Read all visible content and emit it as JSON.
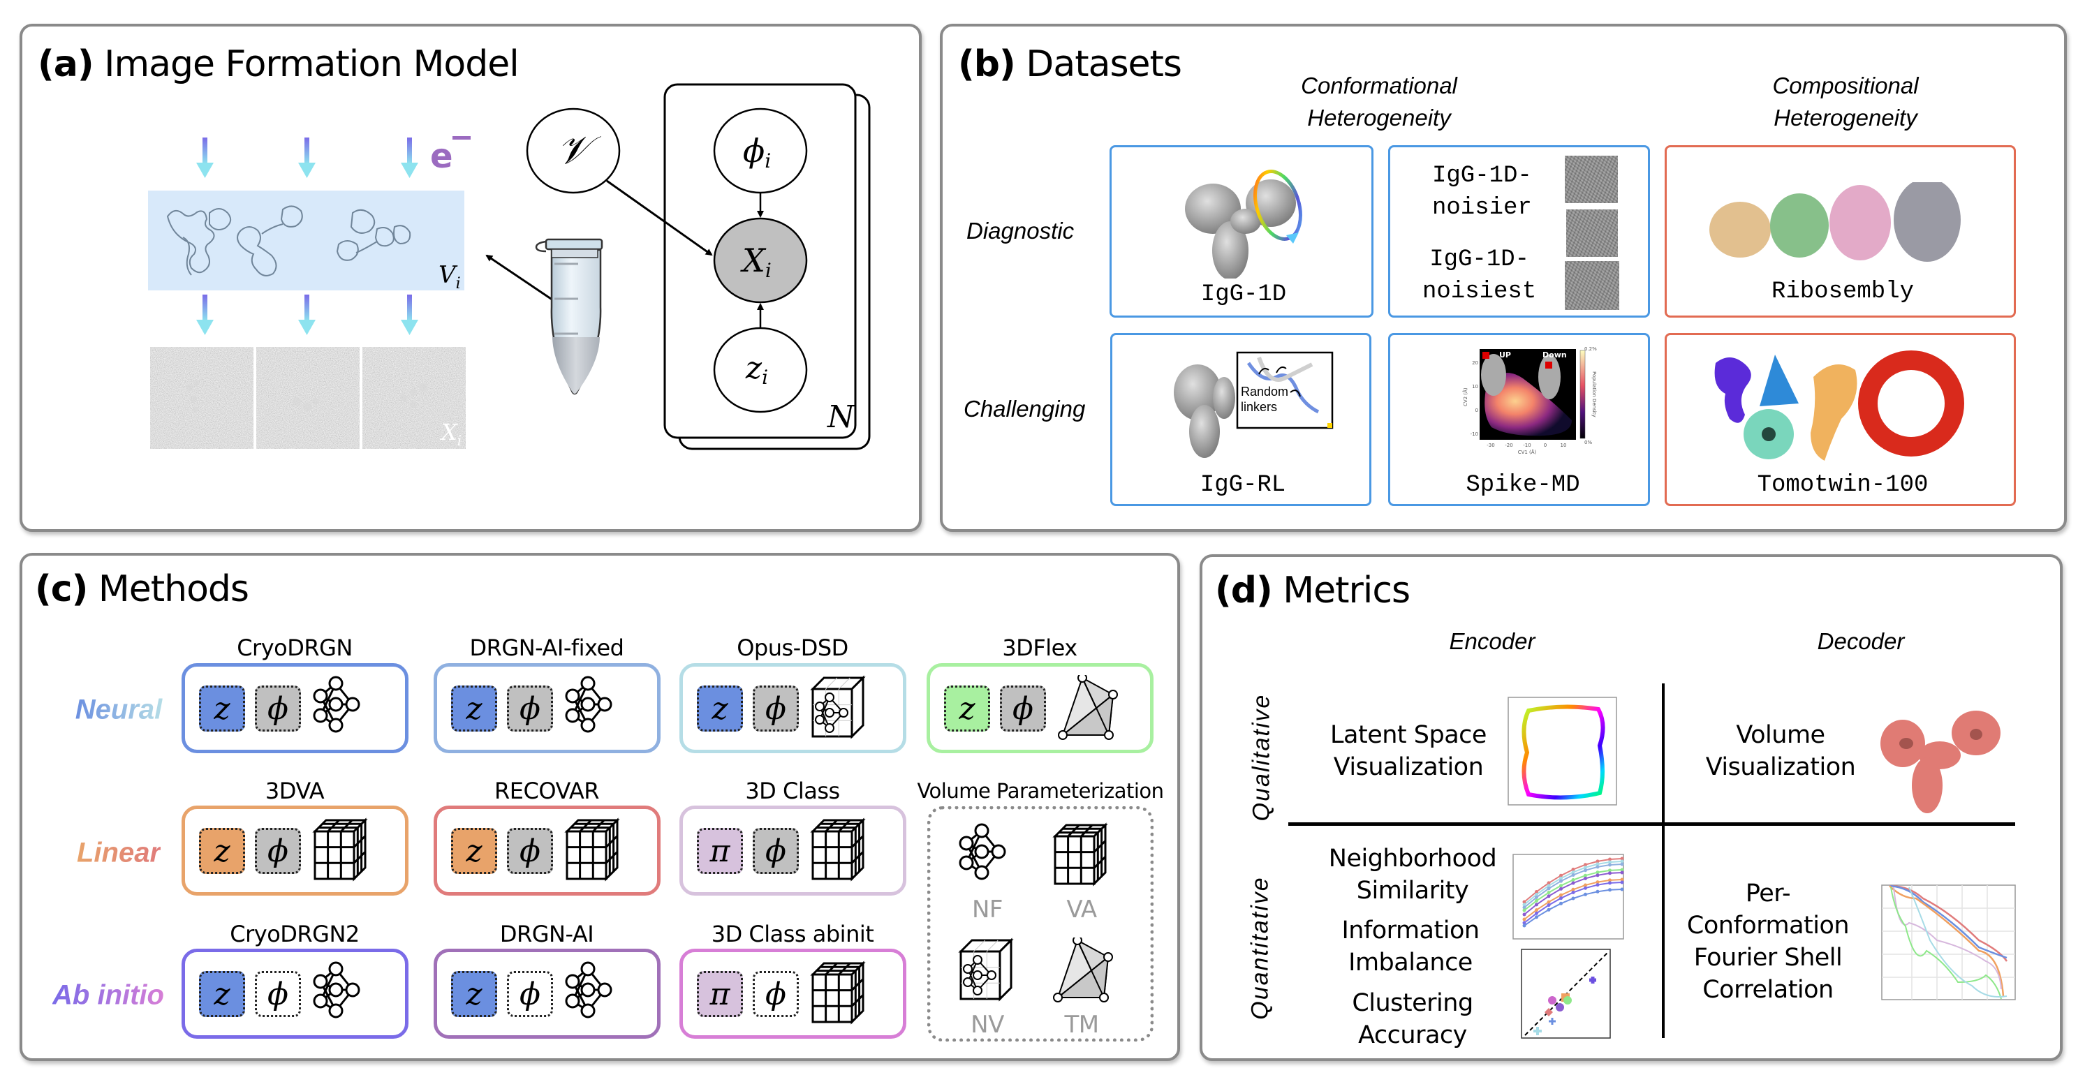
{
  "panel_a": {
    "letter": "(a)",
    "title": "Image Formation Model",
    "electron_label": "e",
    "volume_label": "V",
    "volume_sub": "i",
    "image_label": "X",
    "image_sub": "i",
    "nodes": {
      "global": "𝒱",
      "pose": "ϕ",
      "pose_sub": "i",
      "image": "X",
      "image_sub": "i",
      "latent": "z",
      "latent_sub": "i"
    },
    "plate_label": "N",
    "colors": {
      "electron": "#9b6bc0",
      "band": "#d8e9fa",
      "observed_node": "#c0c0c0"
    }
  },
  "panel_b": {
    "letter": "(b)",
    "title": "Datasets",
    "column_headers": [
      "Conformational\nHeterogeneity",
      "Compositional\nHeterogeneity"
    ],
    "column_headers_lines": [
      [
        "Conformational",
        "Heterogeneity"
      ],
      [
        "Compositional",
        "Heterogeneity"
      ]
    ],
    "row_labels": [
      "Diagnostic",
      "Challenging"
    ],
    "datasets": [
      {
        "name": "IgG-1D",
        "group": "conformational",
        "row": "Diagnostic"
      },
      {
        "name_lines": [
          "IgG-1D-",
          "noisier"
        ],
        "group": "conformational",
        "row": "Diagnostic"
      },
      {
        "name_lines": [
          "IgG-1D-",
          "noisiest"
        ],
        "group": "conformational",
        "row": "Diagnostic"
      },
      {
        "name": "Ribosembly",
        "group": "compositional",
        "row": "Diagnostic"
      },
      {
        "name": "IgG-RL",
        "group": "conformational",
        "row": "Challenging",
        "inset_label_lines": [
          "Random",
          "linkers"
        ]
      },
      {
        "name": "Spike-MD",
        "group": "conformational",
        "row": "Challenging"
      },
      {
        "name": "Tomotwin-100",
        "group": "compositional",
        "row": "Challenging"
      }
    ],
    "spike_plot": {
      "state_labels": [
        "UP",
        "Down"
      ],
      "xlabel": "CV1 (Å)",
      "ylabel": "CV2 (Å)",
      "xticks": [
        "-30",
        "-20",
        "-10",
        "0",
        "10"
      ],
      "yticks": [
        "20",
        "10",
        "0",
        "-10"
      ],
      "colorbar_label": "Population Density",
      "colorbar_max": "0.2%",
      "colorbar_min": "0%"
    },
    "colors": {
      "conformational": "#4a98e3",
      "compositional": "#e26b52"
    }
  },
  "panel_c": {
    "letter": "(c)",
    "title": "Methods",
    "row_labels": [
      {
        "label": "Neural",
        "gradient": [
          "#6b8fe0",
          "#b5dde6"
        ]
      },
      {
        "label": "Linear",
        "gradient": [
          "#e8a36a",
          "#e07b7b"
        ]
      },
      {
        "label": "Ab initio",
        "gradient": [
          "#7a6be8",
          "#d77ed6"
        ]
      }
    ],
    "methods": [
      {
        "name": "CryoDRGN",
        "border": "#6b8fe0",
        "latent": "z",
        "latent_color": "#6b8fe0",
        "pose": "ϕ",
        "pose_color": "#c0c0c0",
        "volume": "NF"
      },
      {
        "name": "DRGN-AI-fixed",
        "border": "#8fb0e0",
        "latent": "z",
        "latent_color": "#6b8fe0",
        "pose": "ϕ",
        "pose_color": "#c0c0c0",
        "volume": "NF"
      },
      {
        "name": "Opus-DSD",
        "border": "#b5dde6",
        "latent": "z",
        "latent_color": "#6b8fe0",
        "pose": "ϕ",
        "pose_color": "#c0c0c0",
        "volume": "NV"
      },
      {
        "name": "3DFlex",
        "border": "#a8f0a0",
        "latent": "z",
        "latent_color": "#a8f0a0",
        "pose": "ϕ",
        "pose_color": "#c0c0c0",
        "volume": "TM"
      },
      {
        "name": "3DVA",
        "border": "#e8a36a",
        "latent": "z",
        "latent_color": "#e8a36a",
        "pose": "ϕ",
        "pose_color": "#c0c0c0",
        "volume": "VA"
      },
      {
        "name": "RECOVAR",
        "border": "#e07b7b",
        "latent": "z",
        "latent_color": "#e8a36a",
        "pose": "ϕ",
        "pose_color": "#c0c0c0",
        "volume": "VA"
      },
      {
        "name": "3D Class",
        "border": "#d7c2dd",
        "latent": "π",
        "latent_color": "#d7c2dd",
        "pose": "ϕ",
        "pose_color": "#c0c0c0",
        "volume": "VA"
      },
      {
        "name": "CryoDRGN2",
        "border": "#7a6be8",
        "latent": "z",
        "latent_color": "#6b8fe0",
        "pose": "ϕ",
        "pose_color": "#ffffff",
        "volume": "NF"
      },
      {
        "name": "DRGN-AI",
        "border": "#a070b8",
        "latent": "z",
        "latent_color": "#6b8fe0",
        "pose": "ϕ",
        "pose_color": "#ffffff",
        "volume": "NF"
      },
      {
        "name": "3D Class abinit",
        "border": "#d77ed6",
        "latent": "π",
        "latent_color": "#d7c2dd",
        "pose": "ϕ",
        "pose_color": "#ffffff",
        "volume": "VA"
      }
    ],
    "volume_parameterization": {
      "title": "Volume Parameterization",
      "items": [
        "NF",
        "VA",
        "NV",
        "TM"
      ]
    }
  },
  "panel_d": {
    "letter": "(d)",
    "title": "Metrics",
    "column_headers": [
      "Encoder",
      "Decoder"
    ],
    "row_labels": [
      "Qualitative",
      "Quantitative"
    ],
    "cells": {
      "encoder_qualitative": [
        "Latent Space",
        "Visualization"
      ],
      "decoder_qualitative": [
        "Volume",
        "Visualization"
      ],
      "encoder_quantitative": [
        [
          "Neighborhood",
          "Similarity"
        ],
        [
          "Information",
          "Imbalance"
        ],
        [
          "Clustering",
          "Accuracy"
        ]
      ],
      "decoder_quantitative": [
        "Per-",
        "Conformation",
        "Fourier Shell",
        "Correlation"
      ]
    }
  }
}
